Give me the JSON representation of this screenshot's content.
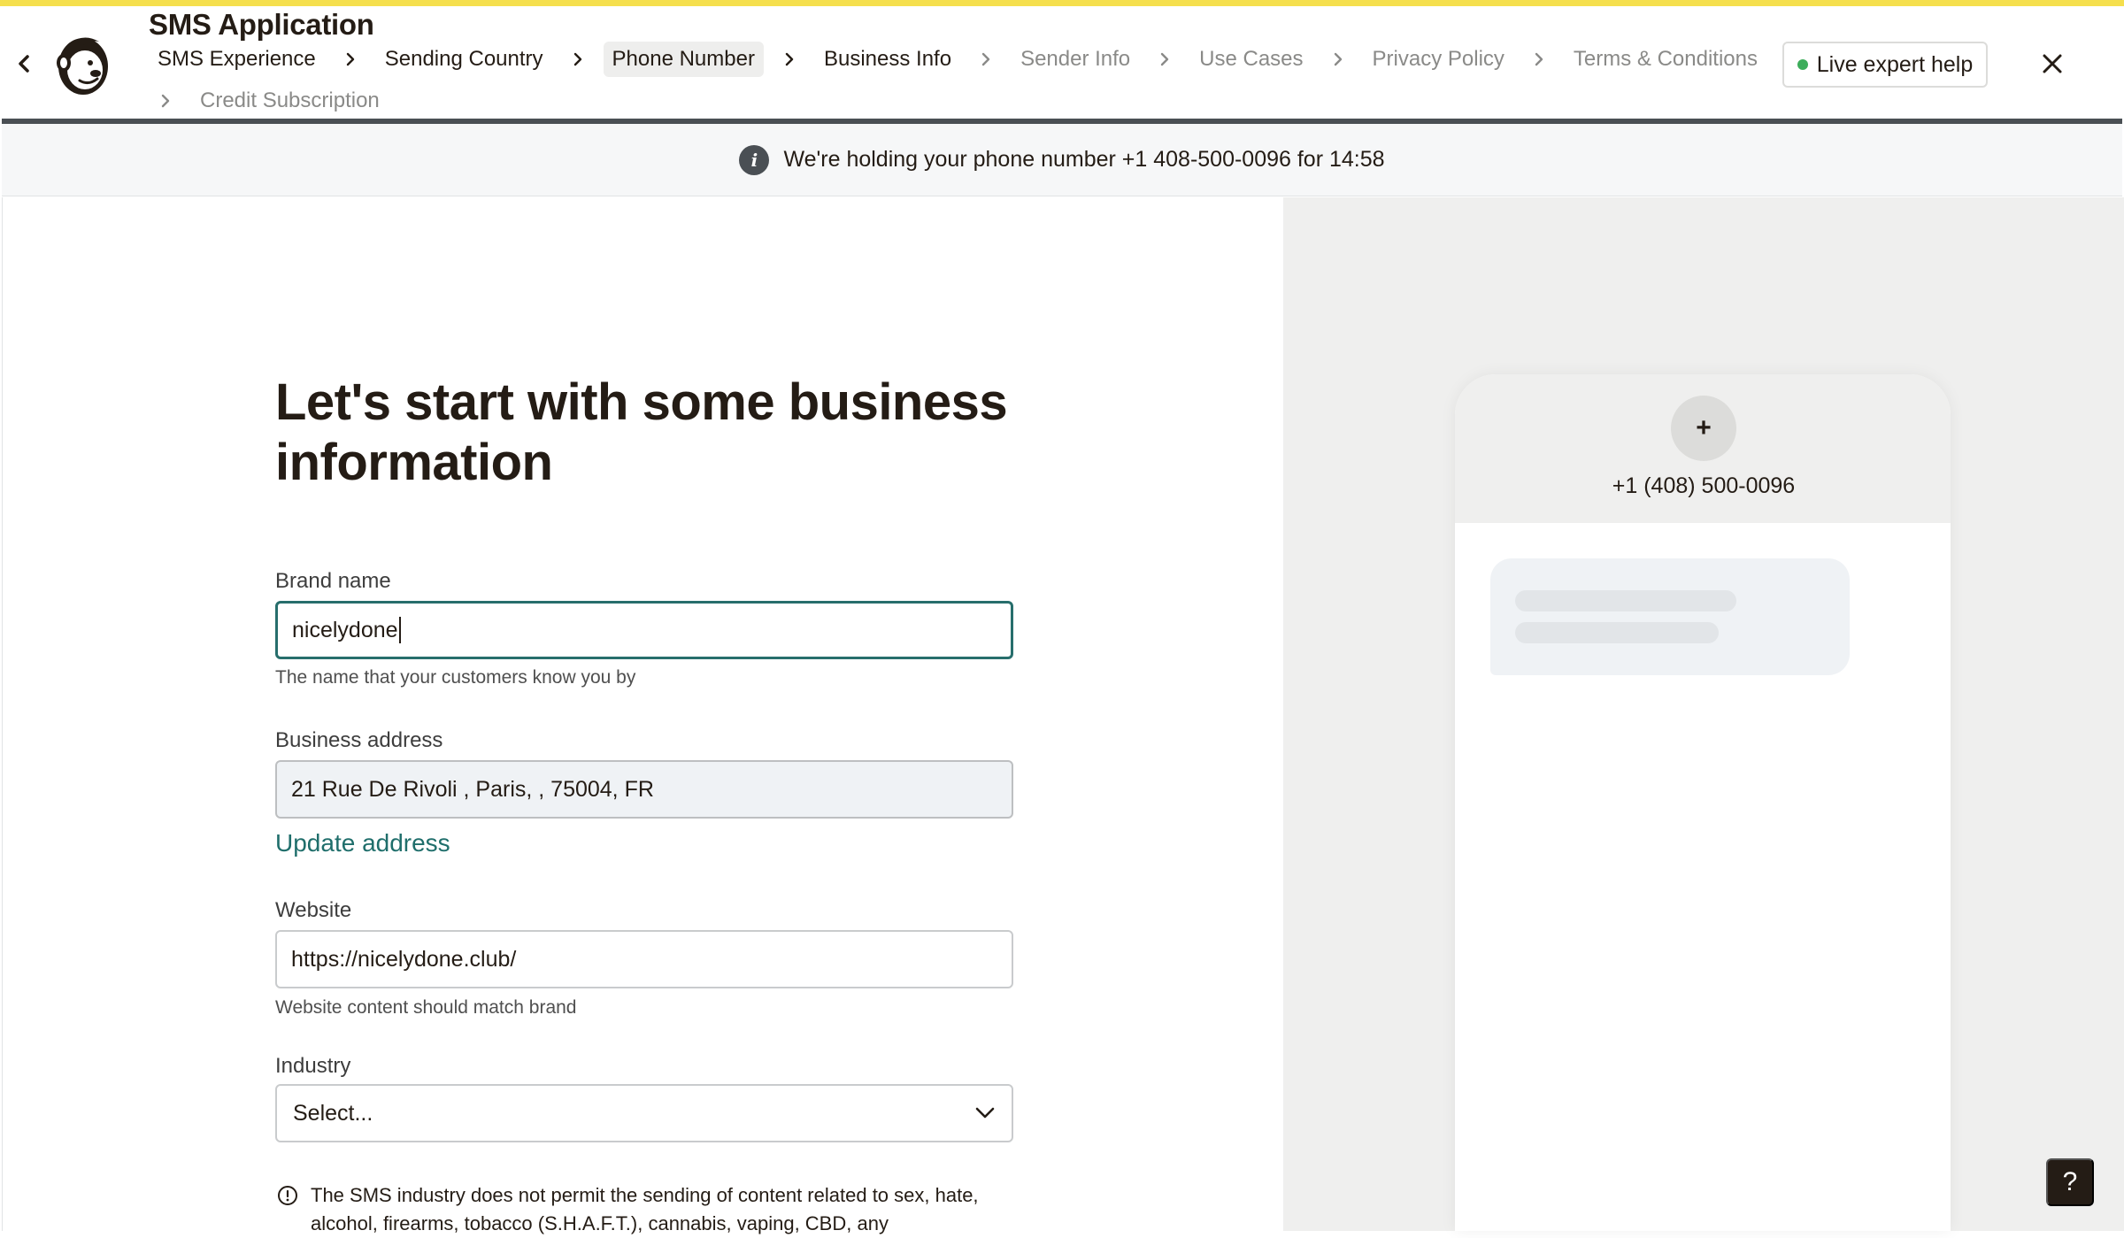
{
  "header": {
    "app_title": "SMS Application",
    "back_icon": "chevron-left-icon",
    "logo_icon": "mailchimp-freddie-logo",
    "live_help_label": "Live expert help",
    "close_icon": "close-icon"
  },
  "breadcrumbs": {
    "row1": [
      {
        "label": "SMS Experience",
        "state": "done"
      },
      {
        "label": "Sending Country",
        "state": "done"
      },
      {
        "label": "Phone Number",
        "state": "active"
      },
      {
        "label": "Business Info",
        "state": "done"
      },
      {
        "label": "Sender Info",
        "state": "future"
      },
      {
        "label": "Use Cases",
        "state": "future"
      },
      {
        "label": "Privacy Policy",
        "state": "future"
      },
      {
        "label": "Terms & Conditions",
        "state": "future"
      }
    ],
    "row2": [
      {
        "label": "Credit Subscription",
        "state": "future"
      }
    ]
  },
  "notice": {
    "icon": "info-icon",
    "text": "We're holding your phone number +1 408-500-0096 for 14:58"
  },
  "form": {
    "heading": "Let's start with some business information",
    "brand": {
      "label": "Brand name",
      "value": "nicelydone",
      "helper": "The name that your customers know you by"
    },
    "address": {
      "label": "Business address",
      "value": "21 Rue De Rivoli , Paris, , 75004, FR",
      "update_link": "Update address"
    },
    "website": {
      "label": "Website",
      "value": "https://nicelydone.club/",
      "helper": "Website content should match brand"
    },
    "industry": {
      "label": "Industry",
      "selected": "Select..."
    },
    "warning": {
      "icon": "alert-circle-icon",
      "text": "The SMS industry does not permit the sending of content related to sex, hate, alcohol, firearms, tobacco (S.H.A.F.T.), cannabis, vaping, CBD, any"
    }
  },
  "preview": {
    "avatar_label": "+",
    "phone_number": "+1 (408) 500-0096"
  },
  "help_fab": {
    "label": "?"
  },
  "colors": {
    "brand_yellow": "#f5df4d",
    "accent_teal": "#276e6c",
    "link_teal": "#1f6e6b",
    "live_green": "#3dad5b",
    "ink": "#241c15"
  }
}
